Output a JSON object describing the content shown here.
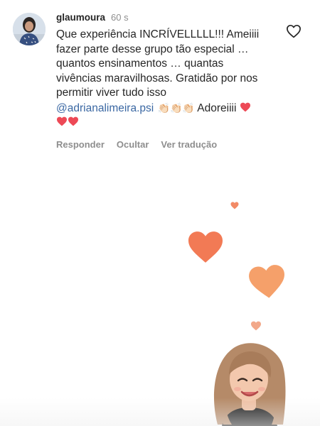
{
  "comment": {
    "username": "glaumoura",
    "time": "60 s",
    "text_lines": [
      "Que experiência INCRÍVELLLLL!!! Ameiiii",
      "fazer parte desse grupo tão especial …",
      "quantos ensinamentos … quantas",
      "vivências maravilhosas. Gratidão por nos",
      "permitir viver tudo isso"
    ],
    "mention": "@adrianalimeira.psi",
    "claps": "👏🏻👏🏻👏🏻",
    "trailing_text": "Adoreiiii",
    "icons": {
      "like": "heart-outline-icon",
      "emoji": "red-heart-emoji-icon",
      "clap": "clapping-hands-icon"
    }
  },
  "actions": {
    "reply": "Responder",
    "hide": "Ocultar",
    "translate": "Ver tradução"
  },
  "colors": {
    "text": "#262626",
    "secondary": "#8e8e8e",
    "mention": "#3b68a3",
    "heart_emoji": "#ed4956",
    "floating_heart": "#f27a55"
  },
  "decor": {
    "floating_hearts": "heart-icon",
    "sticker": "bitmoji-avatar-sticker"
  }
}
